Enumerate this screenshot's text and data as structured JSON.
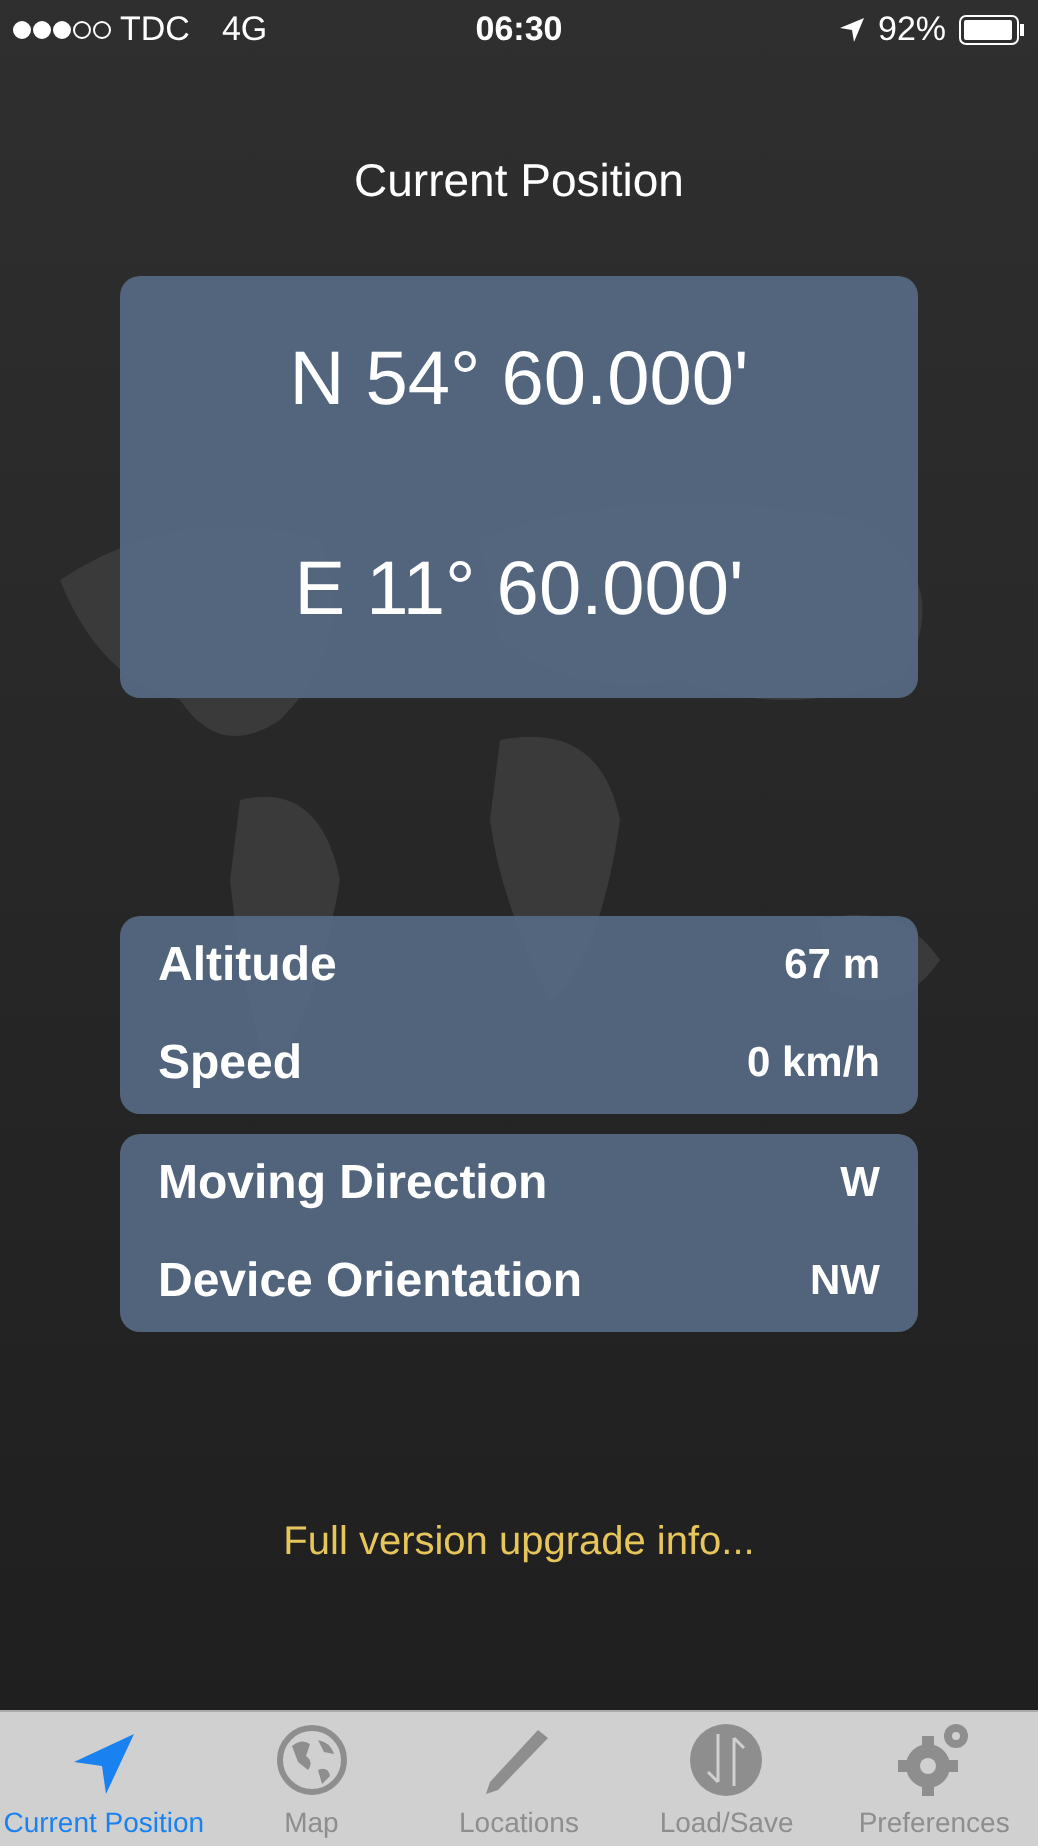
{
  "status_bar": {
    "carrier": "TDC",
    "network": "4G",
    "time": "06:30",
    "battery": "92%"
  },
  "title": "Current Position",
  "coordinates": {
    "latitude": "N 54° 60.000'",
    "longitude": "E 11° 60.000'"
  },
  "info_groups": [
    [
      {
        "label": "Altitude",
        "value": "67 m"
      },
      {
        "label": "Speed",
        "value": "0 km/h"
      }
    ],
    [
      {
        "label": "Moving Direction",
        "value": "W"
      },
      {
        "label": "Device Orientation",
        "value": "NW"
      }
    ]
  ],
  "upgrade_link": "Full version upgrade info...",
  "tabs": [
    {
      "kind": "position",
      "label": "Current Position",
      "selected": true
    },
    {
      "kind": "map",
      "label": "Map",
      "selected": false
    },
    {
      "kind": "locations",
      "label": "Locations",
      "selected": false
    },
    {
      "kind": "loadsave",
      "label": "Load/Save",
      "selected": false
    },
    {
      "kind": "preferences",
      "label": "Preferences",
      "selected": false
    }
  ]
}
